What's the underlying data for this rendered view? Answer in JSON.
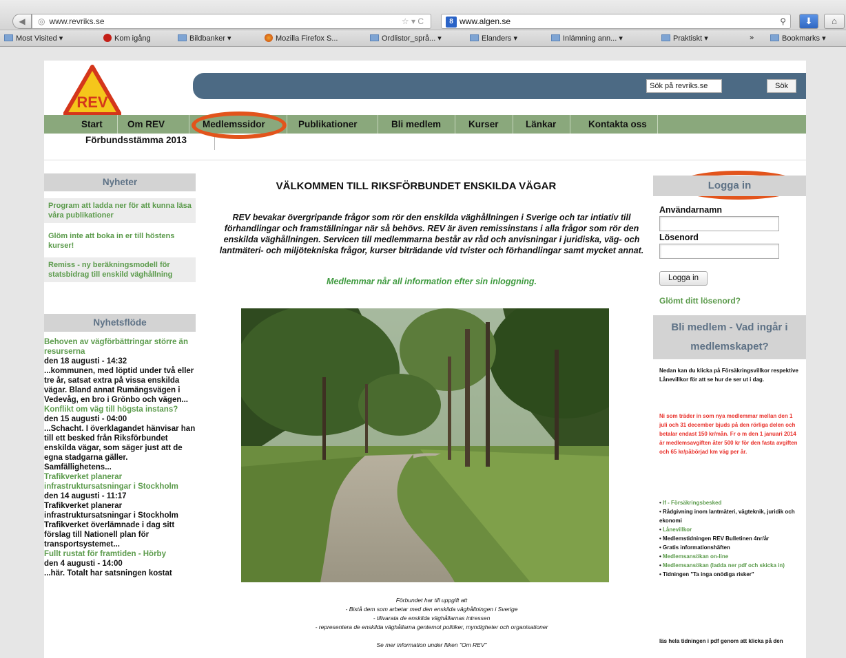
{
  "browser": {
    "url": "www.revriks.se",
    "search_text": "www.algen.se",
    "search_engine_letter": "8",
    "bookmarks": [
      "Most Visited ▾",
      "Kom igång",
      "Bildbanker ▾",
      "Mozilla Firefox S...",
      "Ordlistor_språ... ▾",
      "Elanders ▾",
      "Inlämning ann... ▾",
      "Praktiskt ▾",
      "Bookmarks ▾"
    ],
    "overflow": "»"
  },
  "site": {
    "logo_text": "REV",
    "search_placeholder": "Sök på revriks.se",
    "search_button": "Sök",
    "menu": [
      "Start",
      "Om REV",
      "Medlemssidor",
      "Publikationer",
      "Bli medlem",
      "Kurser",
      "Länkar",
      "Kontakta oss"
    ],
    "submenu": "Förbundsstämma 2013"
  },
  "left": {
    "news_title": "Nyheter",
    "news": [
      "Program att ladda ner för att kunna läsa våra publikationer",
      "Glöm inte att boka in er till höstens kurser!",
      "Remiss - ny beräkningsmodell för statsbidrag till enskild väghållning"
    ],
    "feed_title": "Nyhetsflöde",
    "feed": [
      {
        "title": "Behoven av vägförbättringar större än resurserna",
        "date": "den 18 augusti - 14:32",
        "text": "...kommunen, med löptid under två eller tre år, satsat extra på vissa enskilda vägar. Bland annat Rumängsvägen i Vedevåg, en bro i Grönbo och vägen..."
      },
      {
        "title": "Konflikt om väg till högsta instans?",
        "date": "den 15 augusti - 04:00",
        "text": "...Schacht. I överklagandet hänvisar han till ett besked från Riksförbundet enskilda vägar, som säger just att de egna stadgarna gäller. Samfällighetens..."
      },
      {
        "title": "Trafikverket planerar infrastruktursatsningar i Stockholm",
        "date": "den 14 augusti - 11:17",
        "text": "Trafikverket planerar infrastruktursatsningar i Stockholm Trafikverket överlämnade i dag sitt förslag till Nationell plan för transportsystemet..."
      },
      {
        "title": "Fullt rustat för framtiden - Hörby",
        "date": "den 4 augusti - 14:00",
        "text": "...här. Totalt har satsningen kostat"
      }
    ]
  },
  "center": {
    "welcome": "VÄLKOMMEN TILL RIKSFÖRBUNDET ENSKILDA VÄGAR",
    "intro": "REV bevakar övergripande frågor som rör den enskilda väghållningen i Sverige och tar intiativ till förhandlingar och framställningar när så behövs. REV är även remissinstans i alla frågor som rör den enskilda väghållningen. Servicen till medlemmarna består av råd och anvisningar i juridiska, väg- och lantmäteri- och miljötekniska frågor, kurser biträdande vid tvister och förhandlingar samt mycket annat.",
    "intro_green": "Medlemmar når all information efter sin inloggning.",
    "caption": [
      "Förbundet har till uppgift att",
      "- Bistå dem som arbetar med den enskilda väghållningen i Sverige",
      "- tillvarata de enskilda väghållarnas intressen",
      "- representera de enskilda väghållarna gentemot politiker, myndigheter och organisationer",
      "",
      "Se mer information under fliken \"Om REV\""
    ]
  },
  "right": {
    "login_title": "Logga in",
    "username_label": "Användarnamn",
    "password_label": "Lösenord",
    "login_button": "Logga in",
    "forgot": "Glömt ditt lösenord?",
    "member_title": "Bli medlem - Vad ingår i medlemskapet?",
    "member_text": "Nedan kan du klicka på Försäkringsvillkor respektive Lånevillkor för att se hur de ser ut i dag.",
    "member_red": "Ni som träder in som nya medlemmar mellan den 1 juli och 31 december bjuds på den rörliga delen och betalar endast 150 kr/mån. Fr o m den 1 januari 2014 är medlemsavgiften åter 500 kr för den fasta avgiften och 65 kr/påbörjad km väg per år.",
    "member_list": [
      {
        "text": "If - Försäkringsbesked",
        "green": true
      },
      {
        "text": "Rådgivning inom lantmäteri, vägteknik, juridik och ekonomi",
        "green": false
      },
      {
        "text": "Lånevillkor",
        "green": true
      },
      {
        "text": "Medlemstidningen REV Bulletinen 4nr/år",
        "green": false
      },
      {
        "text": "Gratis informationshäften",
        "green": false
      },
      {
        "text": "Medlemsansökan on-line",
        "green": true
      },
      {
        "text": "Medlemsansökan (ladda ner pdf och skicka in)",
        "green": true
      },
      {
        "text": "Tidningen \"Ta inga onödiga risker\"",
        "green": false
      }
    ],
    "member_foot": "läs hela tidningen i pdf genom att klicka på den"
  }
}
